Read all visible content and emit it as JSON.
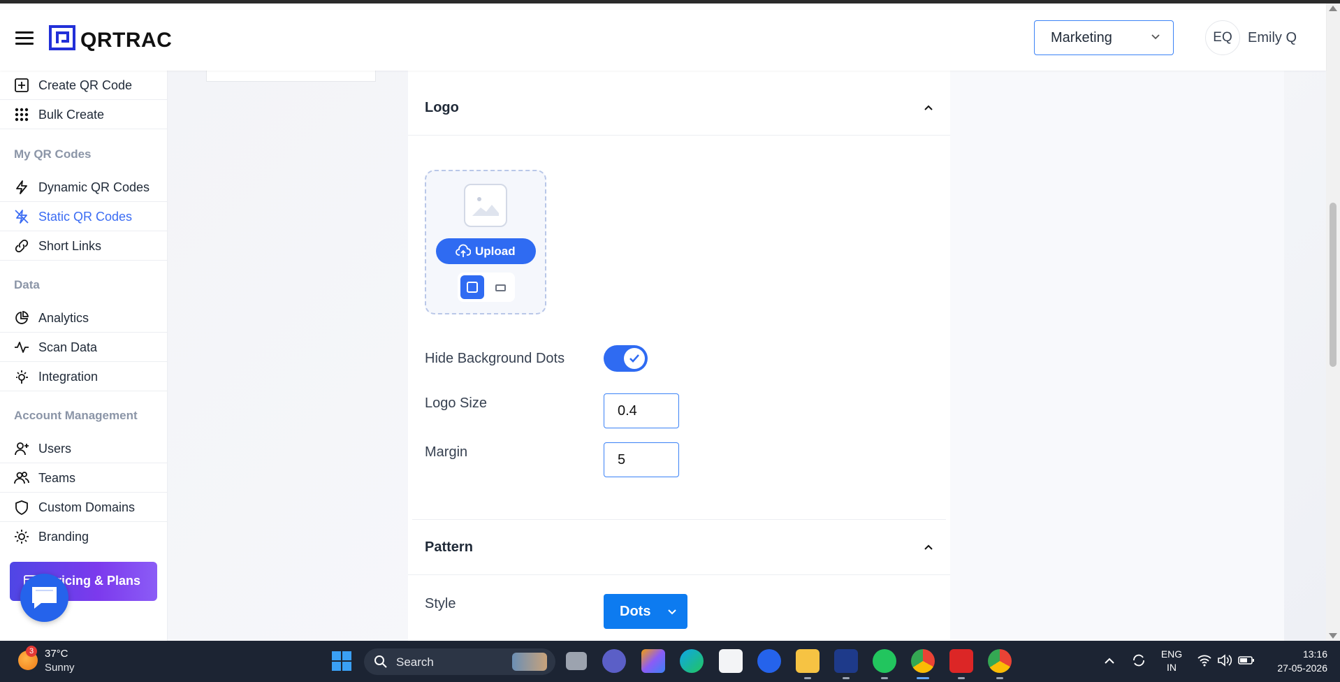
{
  "header": {
    "app_name": "QRTRAC",
    "team_select": "Marketing",
    "user_initials": "EQ",
    "user_name": "Emily Q"
  },
  "sidebar": {
    "items_top": [
      {
        "label": "Create QR Code",
        "icon": "plus-square-icon"
      },
      {
        "label": "Bulk Create",
        "icon": "grid-dots-icon"
      }
    ],
    "section_my_qr": "My QR Codes",
    "items_qr": [
      {
        "label": "Dynamic QR Codes",
        "icon": "lightning-icon"
      },
      {
        "label": "Static QR Codes",
        "icon": "lightning-off-icon",
        "active": true
      },
      {
        "label": "Short Links",
        "icon": "link-icon"
      }
    ],
    "section_data": "Data",
    "items_data": [
      {
        "label": "Analytics",
        "icon": "pie-chart-icon"
      },
      {
        "label": "Scan Data",
        "icon": "activity-icon"
      },
      {
        "label": "Integration",
        "icon": "plug-icon"
      }
    ],
    "section_account": "Account Management",
    "items_account": [
      {
        "label": "Users",
        "icon": "user-plus-icon"
      },
      {
        "label": "Teams",
        "icon": "users-icon"
      },
      {
        "label": "Custom Domains",
        "icon": "shield-icon"
      },
      {
        "label": "Branding",
        "icon": "sun-icon"
      }
    ],
    "pricing_label": "Pricing & Plans"
  },
  "form": {
    "logo_section_title": "Logo",
    "upload_label": "Upload",
    "hide_bg_dots_label": "Hide Background Dots",
    "hide_bg_dots_checked": true,
    "logo_size_label": "Logo Size",
    "logo_size_value": "0.4",
    "margin_label": "Margin",
    "margin_value": "5",
    "pattern_section_title": "Pattern",
    "style_label": "Style",
    "style_value": "Dots"
  },
  "colors": {
    "accent": "#2f6bf2",
    "active_nav": "#3b6cf3",
    "style_button": "#0d7bf0",
    "pricing_gradient_start": "#4f46e5",
    "pricing_gradient_end": "#8b5cf6",
    "taskbar": "#1c2433"
  },
  "taskbar": {
    "weather_temp": "37°C",
    "weather_desc": "Sunny",
    "weather_badge": "3",
    "search_label": "Search",
    "lang_top": "ENG",
    "lang_bottom": "IN",
    "time": "13:16",
    "date": "27-05-2026",
    "apps": [
      "start-icon",
      "task-view-icon",
      "teams-icon",
      "copilot-icon",
      "edge-icon",
      "store-icon",
      "help-icon",
      "file-explorer-icon",
      "arc-icon",
      "whatsapp-icon",
      "chrome-icon",
      "acrobat-icon",
      "chrome-icon"
    ]
  }
}
